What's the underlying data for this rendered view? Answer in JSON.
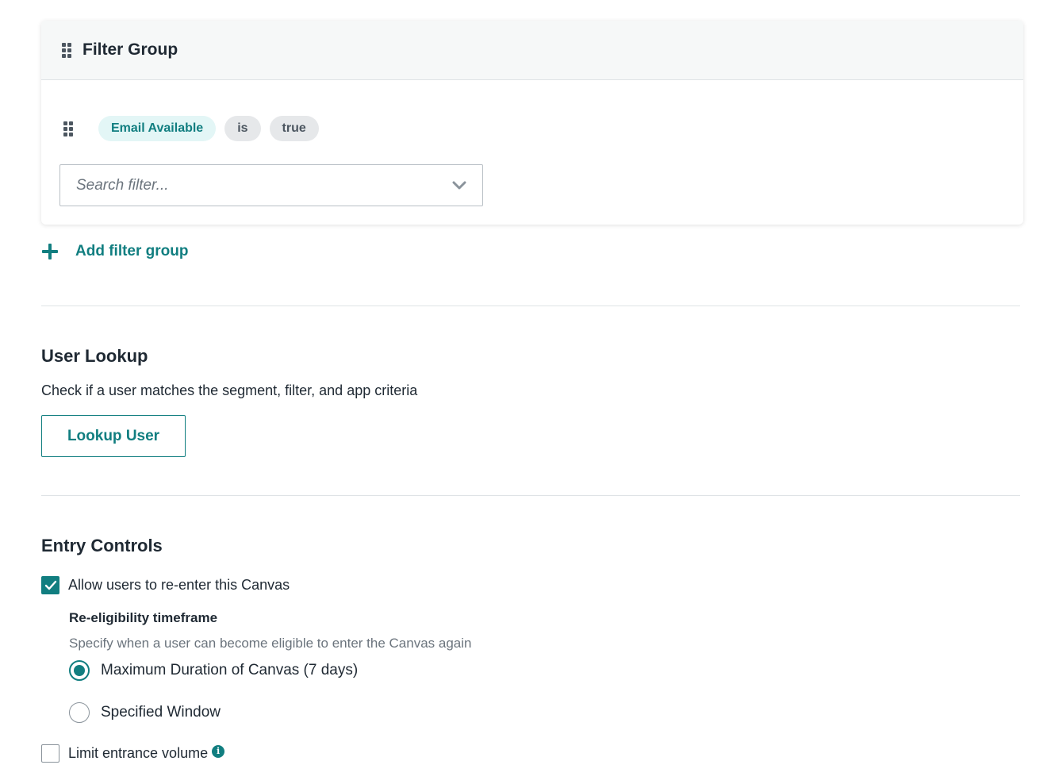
{
  "filter_group": {
    "title": "Filter Group",
    "filter": {
      "field": "Email Available",
      "operator": "is",
      "value": "true"
    },
    "search": {
      "placeholder": "Search filter..."
    },
    "add_group_label": "Add filter group"
  },
  "user_lookup": {
    "title": "User Lookup",
    "description": "Check if a user matches the segment, filter, and app criteria",
    "button_label": "Lookup User"
  },
  "entry_controls": {
    "title": "Entry Controls",
    "reenter": {
      "label": "Allow users to re-enter this Canvas",
      "checked": true
    },
    "reeligibility": {
      "title": "Re-eligibility timeframe",
      "description": "Specify when a user can become eligible to enter the Canvas again",
      "options": [
        {
          "label": "Maximum Duration of Canvas (7 days)",
          "selected": true
        },
        {
          "label": "Specified Window",
          "selected": false
        }
      ]
    },
    "limit_volume": {
      "label": "Limit entrance volume",
      "checked": false,
      "info_icon": "info-icon"
    }
  },
  "colors": {
    "accent": "#117e80",
    "pill_key_bg": "#e3f6f6",
    "pill_neutral_bg": "#e6e8ea"
  }
}
